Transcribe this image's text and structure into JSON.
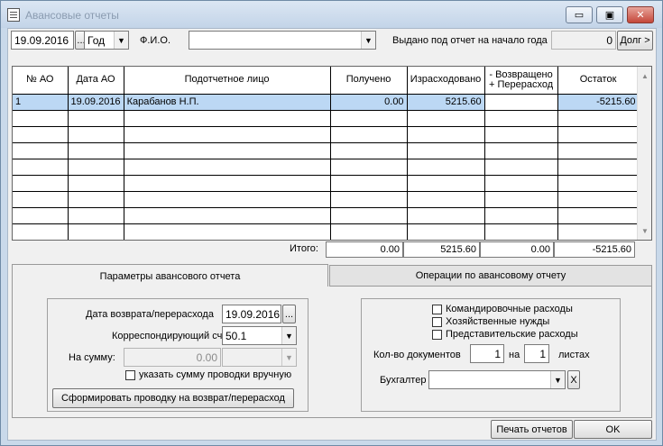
{
  "window": {
    "title": "Авансовые отчеты",
    "minimize": "▭",
    "maximize": "▣",
    "close": "✕"
  },
  "toolbar": {
    "date": "19.09.2016",
    "date_button": "...",
    "period": "Год",
    "fio_label": "Ф.И.О.",
    "fio_value": "",
    "issued_label": "Выдано под отчет на начало года",
    "issued_value": "0",
    "debt_button": "Долг >"
  },
  "table": {
    "headers": [
      "№ АО",
      "Дата АО",
      "Подотчетное лицо",
      "Получено",
      "Израсходовано",
      "- Возвращено\n+ Перерасход",
      "Остаток"
    ],
    "rows": [
      [
        "1",
        "19.09.2016",
        "Карабанов Н.П.",
        "0.00",
        "5215.60",
        "",
        "-5215.60"
      ]
    ],
    "totals_label": "Итого:",
    "totals": [
      "0.00",
      "5215.60",
      "0.00",
      "-5215.60"
    ]
  },
  "tabs": [
    "Параметры авансового отчета",
    "Операции по авансовому отчету"
  ],
  "params": {
    "return_date_label": "Дата возврата/перерасхода",
    "return_date": "19.09.2016",
    "return_date_button": "...",
    "account_label": "Корреспондирующий счет",
    "account": "50.1",
    "sum_label": "На сумму:",
    "sum": "0.00",
    "manual_label": "указать сумму проводки вручную",
    "form_button": "Сформировать проводку на возврат/перерасход"
  },
  "expenses": {
    "travel": "Командировочные расходы",
    "household": "Хозяйственные нужды",
    "representative": "Представительские расходы",
    "docs_label": "Кол-во документов",
    "docs_count": "1",
    "on_label": "на",
    "sheets_count": "1",
    "sheets_label": "листах",
    "accountant_label": "Бухгалтер",
    "accountant": "",
    "clear_button": "X"
  },
  "footer": {
    "print_button": "Печать отчетов",
    "ok_button": "OK"
  }
}
